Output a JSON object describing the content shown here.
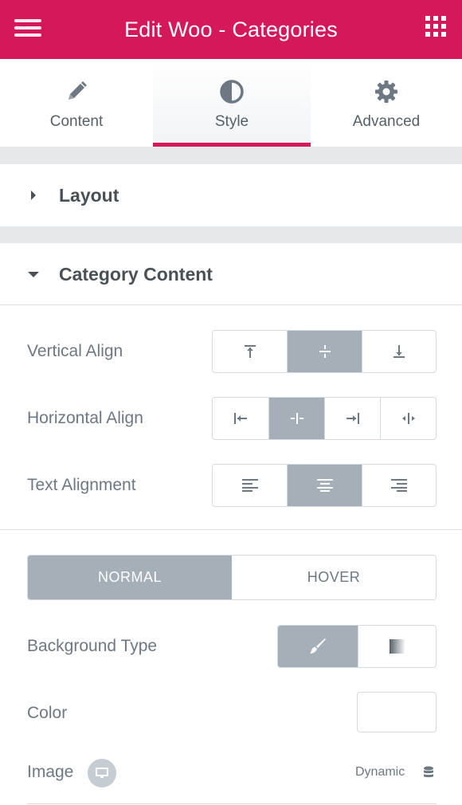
{
  "header": {
    "title": "Edit Woo - Categories",
    "menu_icon": "hamburger-menu-icon",
    "apps_icon": "grid-apps-icon",
    "bg_color": "#d5185c"
  },
  "tabs": [
    {
      "label": "Content",
      "icon": "pencil-icon",
      "active": false
    },
    {
      "label": "Style",
      "icon": "half-circle-contrast-icon",
      "active": true
    },
    {
      "label": "Advanced",
      "icon": "gear-icon",
      "active": false
    }
  ],
  "sections": {
    "layout": {
      "label": "Layout",
      "expanded": false
    },
    "category_content": {
      "label": "Category Content",
      "expanded": true
    }
  },
  "controls": {
    "vertical_align": {
      "label": "Vertical Align",
      "options": [
        "align-top-icon",
        "align-middle-icon",
        "align-bottom-icon"
      ],
      "selected": 1
    },
    "horizontal_align": {
      "label": "Horizontal Align",
      "options": [
        "align-left-icon",
        "align-center-icon",
        "align-right-icon",
        "align-stretch-icon"
      ],
      "selected": 1
    },
    "text_alignment": {
      "label": "Text Alignment",
      "options": [
        "text-align-left-icon",
        "text-align-center-icon",
        "text-align-right-icon"
      ],
      "selected": 1
    },
    "state_tabs": {
      "normal": "NORMAL",
      "hover": "HOVER",
      "selected": "normal"
    },
    "background_type": {
      "label": "Background Type",
      "options": [
        "classic-brush-icon",
        "gradient-icon"
      ],
      "selected": 0
    },
    "color": {
      "label": "Color",
      "value": ""
    },
    "image": {
      "label": "Image",
      "responsive_icon": "desktop-monitor-icon",
      "dynamic_label": "Dynamic",
      "dynamic_icon": "database-icon"
    }
  },
  "colors": {
    "accent": "#d5185c",
    "active_segment": "#a4afb7",
    "label_text": "#6d7882",
    "heading_text": "#495157"
  }
}
